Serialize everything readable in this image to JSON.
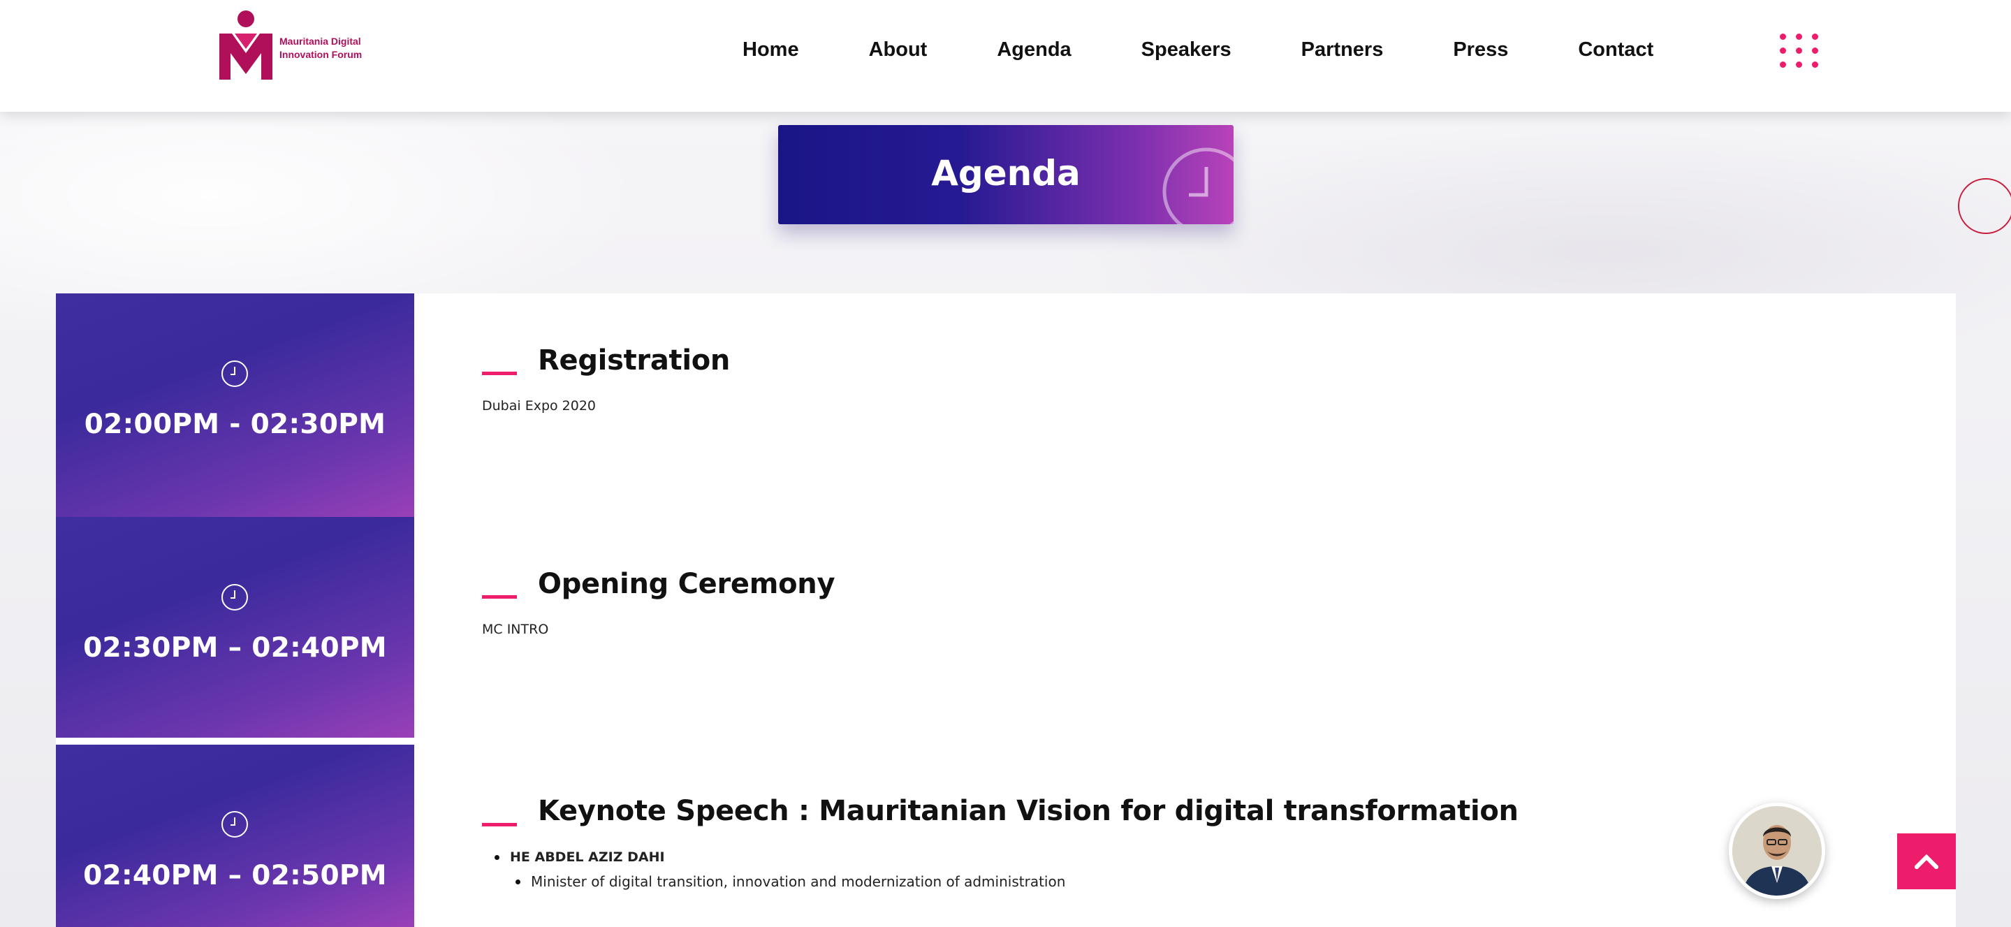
{
  "brand": {
    "name": "Mauritania Digital\nInnovation Forum",
    "logo_icon": "mdif-logo-icon",
    "accent_color": "#ee1d6b",
    "primary_color": "#1a1587"
  },
  "nav": {
    "items": [
      "Home",
      "About",
      "Agenda",
      "Speakers",
      "Partners",
      "Press",
      "Contact"
    ],
    "menu_icon": "dots-grid-icon"
  },
  "banner": {
    "title": "Agenda",
    "icon": "clock-icon"
  },
  "agenda": [
    {
      "time": "02:00PM - 02:30PM",
      "title": "Registration",
      "subtitle": "Dubai Expo 2020"
    },
    {
      "time": "02:30PM – 02:40PM",
      "title": "Opening Ceremony",
      "subtitle": "MC INTRO"
    },
    {
      "time": "02:40PM – 02:50PM",
      "title": "Keynote Speech : Mauritanian Vision for digital transformation",
      "speaker_name": "HE ABDEL AZIZ DAHI",
      "speaker_role": "Minister of digital transition, innovation and modernization of administration"
    }
  ],
  "chat_avatar_icon": "person-avatar-icon",
  "scroll_top_icon": "chevron-up-icon"
}
